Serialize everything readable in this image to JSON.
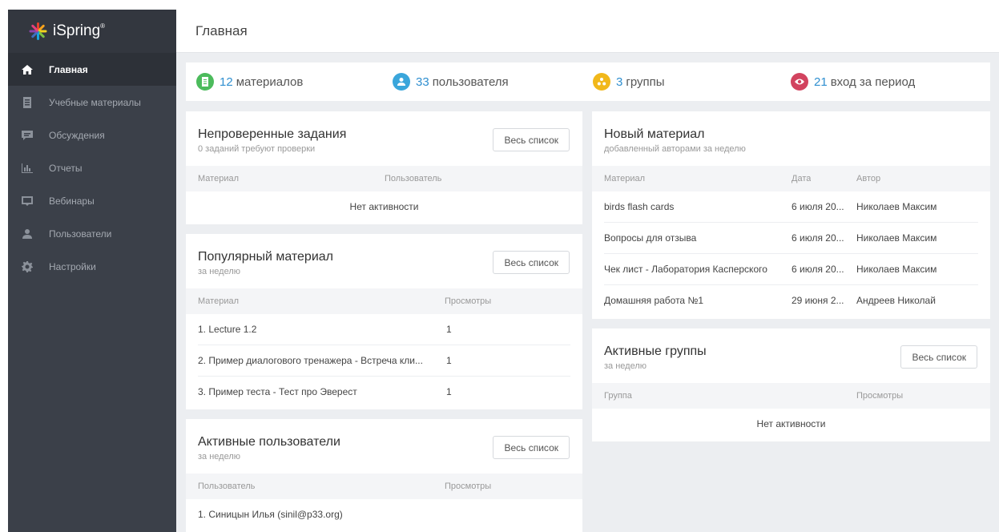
{
  "app": {
    "name": "iSpring",
    "trademark": "®"
  },
  "header": {
    "title": "Главная"
  },
  "sidebar": {
    "items": [
      {
        "label": "Главная",
        "icon": "home-icon"
      },
      {
        "label": "Учебные материалы",
        "icon": "book-icon"
      },
      {
        "label": "Обсуждения",
        "icon": "chat-icon"
      },
      {
        "label": "Отчеты",
        "icon": "bar-chart-icon"
      },
      {
        "label": "Вебинары",
        "icon": "webinar-icon"
      },
      {
        "label": "Пользователи",
        "icon": "user-icon"
      },
      {
        "label": "Настройки",
        "icon": "gear-icon"
      }
    ]
  },
  "stats": [
    {
      "num": "12",
      "label": "материалов",
      "color": "#4cbb5c",
      "icon": "document-icon"
    },
    {
      "num": "33",
      "label": "пользователя",
      "color": "#3aa6db",
      "icon": "user-icon"
    },
    {
      "num": "3",
      "label": "группы",
      "color": "#f1b81b",
      "icon": "group-icon"
    },
    {
      "num": "21",
      "label": "вход за период",
      "color": "#d2435f",
      "icon": "eye-icon"
    }
  ],
  "unchecked": {
    "title": "Непроверенные задания",
    "subtitle": "0 заданий требуют проверки",
    "button": "Весь список",
    "col1": "Материал",
    "col2": "Пользователь",
    "empty": "Нет активности"
  },
  "popular": {
    "title": "Популярный материал",
    "subtitle": "за неделю",
    "button": "Весь список",
    "col1": "Материал",
    "col2": "Просмотры",
    "rows": [
      {
        "name": "1. Lecture 1.2",
        "views": "1"
      },
      {
        "name": "2. Пример диалогового тренажера - Встреча кли...",
        "views": "1"
      },
      {
        "name": "3. Пример теста - Тест про Эверест",
        "views": "1"
      }
    ]
  },
  "active_users": {
    "title": "Активные пользователи",
    "subtitle": "за неделю",
    "button": "Весь список",
    "col1": "Пользователь",
    "col2": "Просмотры",
    "rows": [
      {
        "name": "1. Синицын Илья (sinil@p33.org)",
        "views": ""
      }
    ]
  },
  "new_material": {
    "title": "Новый материал",
    "subtitle": "добавленный авторами за неделю",
    "col1": "Материал",
    "col2": "Дата",
    "col3": "Автор",
    "rows": [
      {
        "name": "birds flash cards",
        "date": "6 июля 20...",
        "author": "Николаев Максим"
      },
      {
        "name": "Вопросы для отзыва",
        "date": "6 июля 20...",
        "author": "Николаев Максим"
      },
      {
        "name": "Чек лист - Лаборатория Касперского",
        "date": "6 июля 20...",
        "author": "Николаев Максим"
      },
      {
        "name": "Домашняя работа №1",
        "date": "29 июня 2...",
        "author": "Андреев Николай"
      }
    ]
  },
  "active_groups": {
    "title": "Активные группы",
    "subtitle": "за неделю",
    "button": "Весь список",
    "col1": "Группа",
    "col2": "Просмотры",
    "empty": "Нет активности"
  }
}
